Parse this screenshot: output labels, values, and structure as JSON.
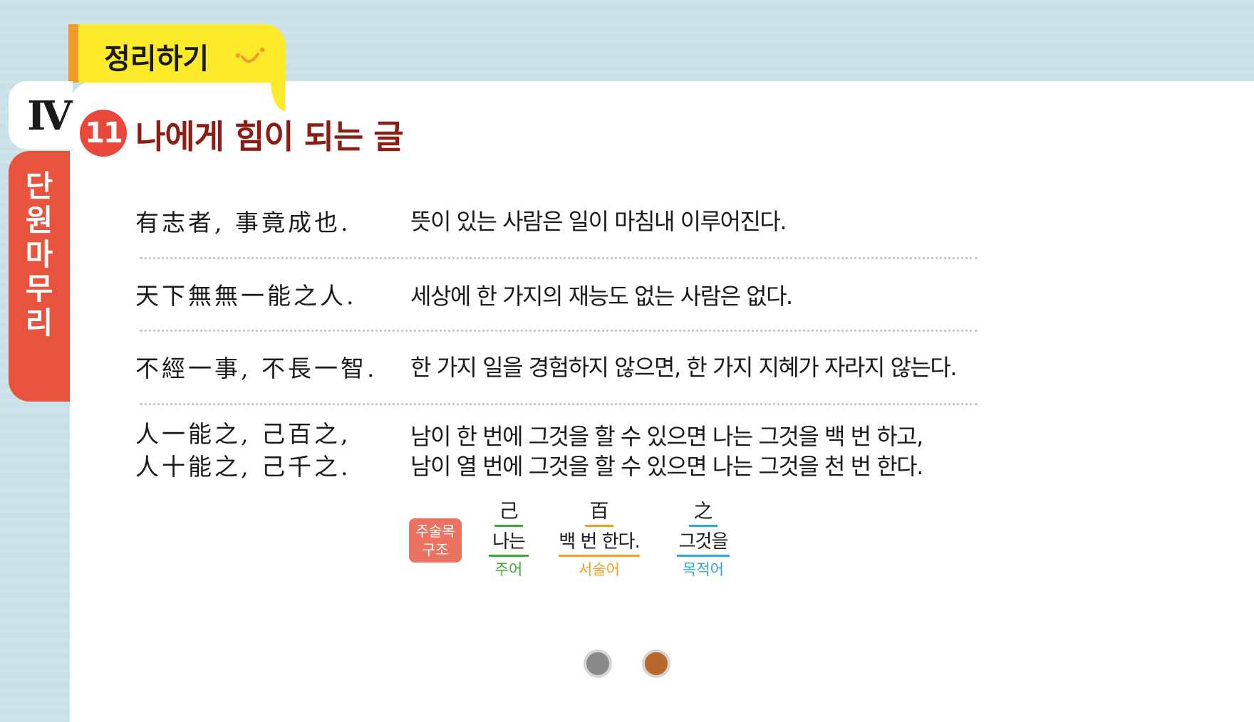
{
  "header": {
    "summary_label": "정리하기",
    "unit_numeral": "Ⅳ",
    "unit_label": [
      "단",
      "원",
      "마",
      "무",
      "리"
    ],
    "lesson_number": "11",
    "lesson_title": "나에게 힘이 되는 글"
  },
  "sentences": [
    {
      "hanja": "有志者, 事竟成也.",
      "korean": "뜻이 있는 사람은 일이 마침내 이루어진다."
    },
    {
      "hanja": "天下無無一能之人.",
      "korean": "세상에 한 가지의 재능도 없는 사람은 없다."
    },
    {
      "hanja": "不經一事, 不長一智.",
      "korean": "한 가지 일을 경험하지 않으면, 한 가지 지혜가 자라지 않는다."
    },
    {
      "hanja": "人一能之, 己百之,\n人十能之, 己千之.",
      "korean": "남이 한 번에 그것을 할 수 있으면 나는 그것을 백 번 하고,\n남이 열 번에 그것을 할 수 있으면 나는 그것을 천 번 한다."
    }
  ],
  "structure": {
    "badge": [
      "주술목",
      "구조"
    ],
    "items": [
      {
        "hanja": "己",
        "korean": "나는",
        "label": "주어",
        "color": "#3aaa35"
      },
      {
        "hanja": "百",
        "korean": "백 번 한다.",
        "label": "서술어",
        "color": "#f0a020"
      },
      {
        "hanja": "之",
        "korean": "그것을",
        "label": "목적어",
        "color": "#2aa8e0"
      }
    ]
  },
  "pager": {
    "colors": [
      "#8a8a8a",
      "#b8692e"
    ]
  }
}
